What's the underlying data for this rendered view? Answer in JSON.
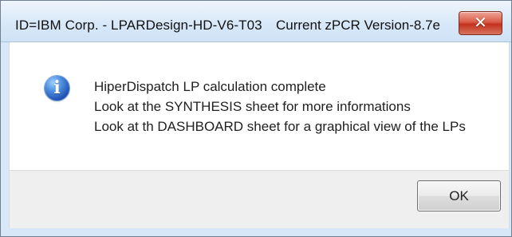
{
  "window": {
    "title": "ID=IBM Corp. - LPARDesign-HD-V6-T03",
    "version": "Current zPCR Version-8.7e",
    "close_icon": "close-icon"
  },
  "message": {
    "icon": "info-icon",
    "icon_glyph": "i",
    "lines": [
      "HiperDispatch LP calculation complete",
      "Look at the SYNTHESIS sheet for more informations",
      "Look at th DASHBOARD sheet for a graphical view of the LPs"
    ]
  },
  "buttons": {
    "ok": "OK"
  },
  "colors": {
    "title_bar": "#d8e8f8",
    "close_button": "#c2311d",
    "info_icon": "#1d4fb2",
    "content_background": "#ffffff",
    "button_area": "#efefef"
  }
}
